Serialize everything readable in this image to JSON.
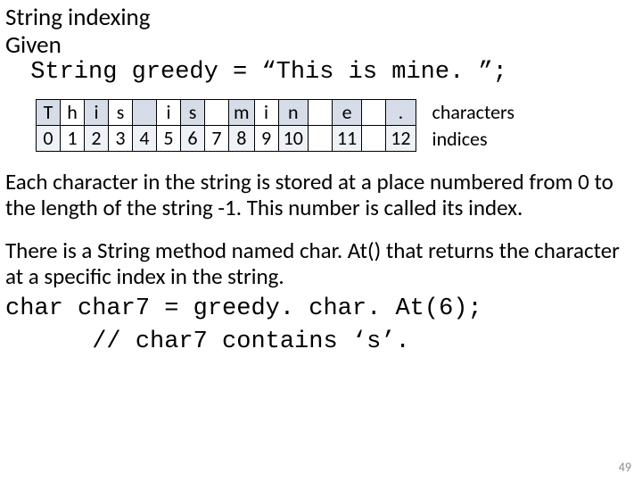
{
  "title": "String indexing",
  "given": "Given",
  "decl": " String greedy = “This is mine. ”;",
  "table": {
    "chars": [
      "T",
      "h",
      "i",
      "s",
      " ",
      "i",
      "s",
      " ",
      "m",
      "i",
      "n",
      " ",
      "e",
      " ",
      "."
    ],
    "indices": [
      "0",
      "1",
      "2",
      "3",
      "4",
      "5",
      "6",
      "7",
      "8",
      "9",
      "10",
      " ",
      "11",
      " ",
      "12"
    ],
    "label_chars": "characters",
    "label_idx": "indices"
  },
  "p1": "Each character in the string is stored at a place numbered from 0 to the length of the string -1.  This number is called its index.",
  "p2": "There is a String method named char. At() that returns the character at a specific index in the string.",
  "code1": "char char7 = greedy. char. At(6);",
  "code2": "      // char7 contains ‘s’.",
  "page": "49",
  "chart_data": {
    "type": "table",
    "title": "String indexing",
    "columns": [
      "index",
      "character"
    ],
    "rows": [
      [
        0,
        "T"
      ],
      [
        1,
        "h"
      ],
      [
        2,
        "i"
      ],
      [
        3,
        "s"
      ],
      [
        4,
        " "
      ],
      [
        5,
        "i"
      ],
      [
        6,
        "s"
      ],
      [
        7,
        " "
      ],
      [
        8,
        "m"
      ],
      [
        9,
        "i"
      ],
      [
        10,
        "n"
      ],
      [
        11,
        "e"
      ],
      [
        12,
        "."
      ]
    ]
  }
}
